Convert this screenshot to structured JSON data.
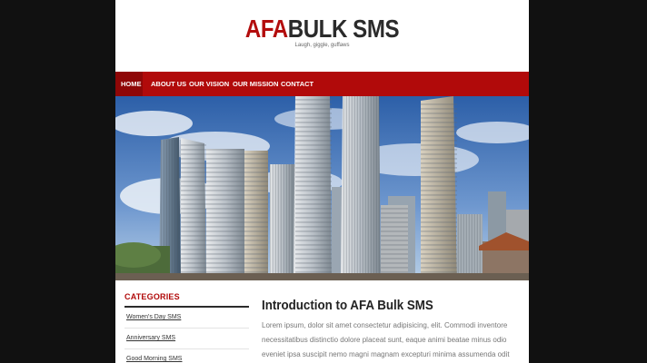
{
  "site": {
    "logo_accent": "AFA",
    "logo_rest": "BULK SMS",
    "tagline": "Laugh, giggle, guffaws",
    "accent_color": "#b10a0a"
  },
  "nav": {
    "items": [
      "HOME",
      "ABOUT US",
      "OUR VISION",
      "OUR MISSION",
      "CONTACT"
    ],
    "active": "HOME"
  },
  "hero": {
    "alt": "city-skyline-banner"
  },
  "sidebar": {
    "title": "CATEGORIES",
    "items": [
      "Women's Day SMS",
      "Anniversary SMS",
      "Good Morning SMS"
    ]
  },
  "main": {
    "title": "Introduction to AFA Bulk SMS",
    "body": "Lorem ipsum, dolor sit amet consectetur adipisicing, elit. Commodi inventore necessitatibus distinctio dolore placeat sunt, eaque animi beatae minus odio eveniet ipsa suscipit nemo magni magnam excepturi minima assumenda odit"
  }
}
